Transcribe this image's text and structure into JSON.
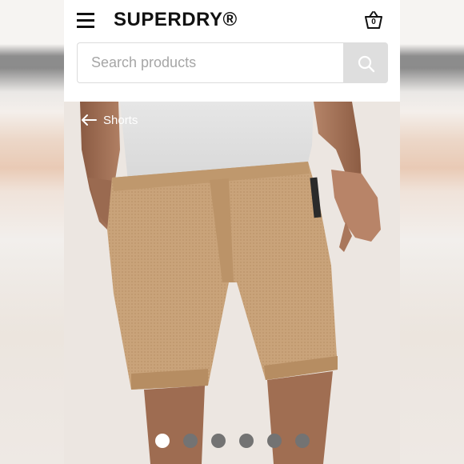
{
  "header": {
    "brand": "SUPERDRY®",
    "basket_count": "0"
  },
  "search": {
    "placeholder": "Search products",
    "value": ""
  },
  "hero": {
    "breadcrumb_label": "Shorts",
    "image_description_icon": "product-photo",
    "carousel": {
      "total": 6,
      "active_index": 0
    }
  },
  "colors": {
    "brand_text": "#111111",
    "search_button_bg": "#dedede",
    "dot_inactive": "#737373",
    "dot_active": "#ffffff"
  }
}
